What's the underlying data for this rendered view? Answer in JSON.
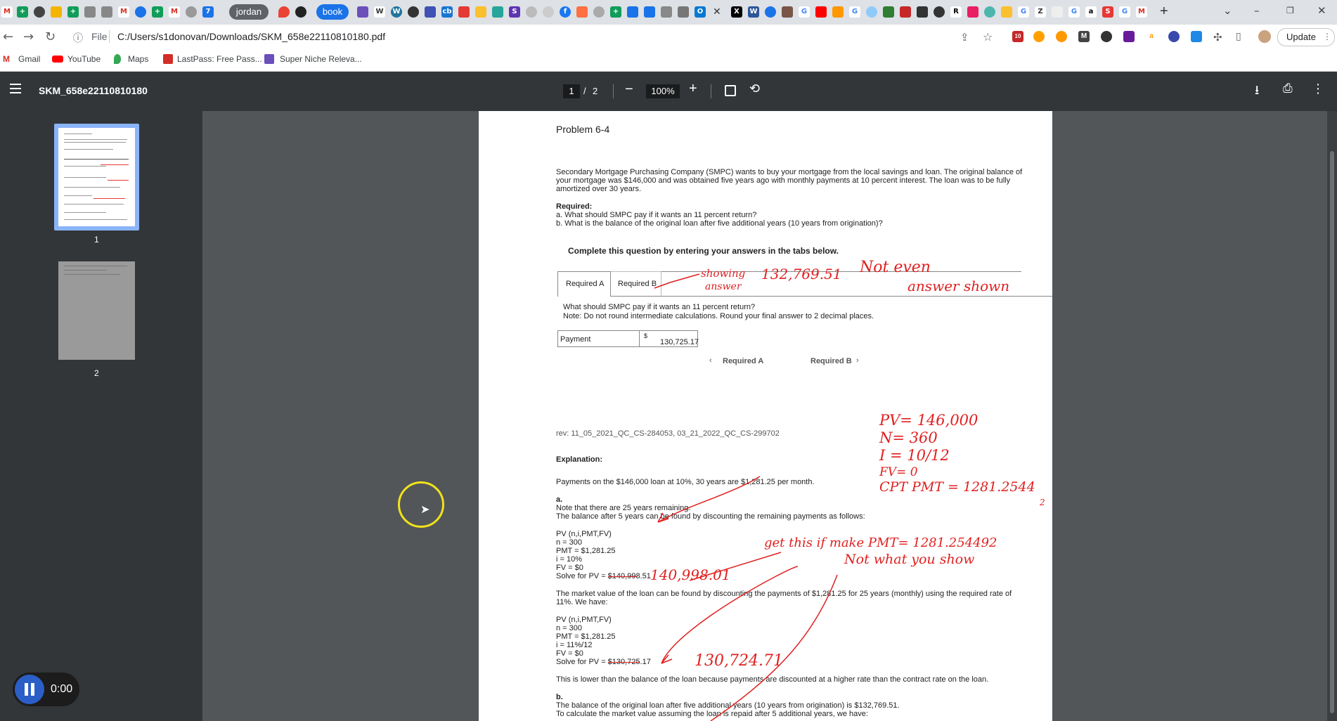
{
  "browser": {
    "tab_pills": [
      "jordan",
      "book"
    ],
    "address": {
      "scheme": "File",
      "url": "C:/Users/s1donovan/Downloads/SKM_658e22110810180.pdf"
    },
    "update_label": "Update",
    "ext_badge": "10",
    "bookmarks": [
      "Gmail",
      "YouTube",
      "Maps",
      "LastPass: Free Pass...",
      "Super Niche Releva..."
    ]
  },
  "pdf": {
    "title": "SKM_658e22110810180",
    "page_current": "1",
    "page_sep": "/",
    "page_total": "2",
    "zoom": "100%",
    "thumbnails": [
      "1",
      "2"
    ]
  },
  "document": {
    "heading": "Problem 6-4",
    "intro": [
      "Secondary Mortgage Purchasing Company (SMPC) wants to buy your mortgage from the local savings and loan. The original balance of",
      "your mortgage was $146,000 and was obtained five years ago with monthly payments at 10 percent interest. The loan was to be fully",
      "amortized over 30 years."
    ],
    "required_label": "Required:",
    "required_a": "a. What should SMPC pay if it wants an 11 percent return?",
    "required_b": "b. What is the balance of the original loan after five additional years (10 years from origination)?",
    "complete_text": "Complete this question by entering your answers in the tabs below.",
    "tab_a": "Required A",
    "tab_b": "Required B",
    "question": "What should SMPC pay if it wants an 11 percent return?",
    "note": "Note: Do not round intermediate calculations. Round your final answer to 2 decimal places.",
    "payment_label": "Payment",
    "payment_currency": "$",
    "payment_value": "130,725.17",
    "nav_prev": "Required A",
    "nav_next": "Required B",
    "rev": "rev: 11_05_2021_QC_CS-284053, 03_21_2022_QC_CS-299702",
    "explanation_label": "Explanation:",
    "payments_line": "Payments on the $146,000 loan at 10%, 30 years are $1,281.25 per month.",
    "a_label": "a.",
    "a_lines": [
      "Note that there are 25 years remaining.",
      "The balance after 5 years can be found by discounting the remaining payments as follows:"
    ],
    "calc1": [
      "PV (n,i,PMT,FV)",
      "n = 300",
      "PMT = $1,281.25",
      "i = 10%",
      "FV = $0",
      "Solve for PV = $140,998.51"
    ],
    "market_lines": [
      "The market value of the loan can be found by discounting the payments of $1,281.25 for 25 years (monthly) using the required rate of",
      "11%. We have:"
    ],
    "calc2": [
      "PV (n,i,PMT,FV)",
      "n = 300",
      "PMT = $1,281.25",
      "i = 11%/12",
      "FV = $0",
      "Solve for PV = $130,725.17"
    ],
    "lower_line": "This is lower than the balance of the loan because payments are discounted at a higher rate than the contract rate on the loan.",
    "b_label": "b.",
    "b_lines": [
      "The balance of the original loan after five additional years (10 years from origination) is $132,769.51.",
      "To calculate the market value assuming the loan is repaid after 5 additional years, we have:"
    ]
  },
  "handwriting": {
    "showing": "showing",
    "answer": "answer",
    "value": "132,769.51",
    "not_even": "Not even",
    "answer_shown": "answer shown",
    "pv": "PV= 146,000",
    "n": "N= 360",
    "i": "I = 10/12",
    "fv": "FV= 0",
    "cpt": "CPT PMT  = 1281.2544",
    "cpt_sub": "2",
    "get_this": "get this if make PMT= 1281.254492",
    "not_what": "Not what you show",
    "pv1": "140,998.01",
    "pv2": "130,724.71"
  },
  "recorder": {
    "time": "0:00"
  }
}
